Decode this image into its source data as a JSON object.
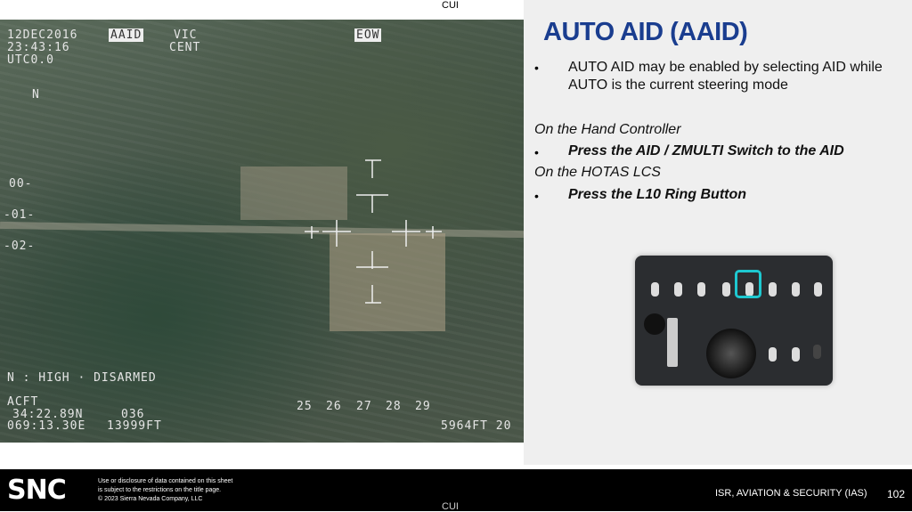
{
  "classification_top": "CUI",
  "classification_bottom": "CUI",
  "video": {
    "date": "12DEC2016",
    "time": "23:43:16",
    "utc": "UTC0.0",
    "mode_badge": "AAID",
    "vic": "VIC",
    "cent": "CENT",
    "eow": "EOW",
    "north": "N",
    "scale": [
      "00-",
      "-01-",
      "-02-"
    ],
    "status": "N : HIGH · DISARMED",
    "acft": "ACFT",
    "lat": "34:22.89N",
    "lon": "069:13.30E",
    "heading": "036",
    "altitude": "13999FT",
    "heading_ticks": [
      "25",
      "26",
      "27",
      "28",
      "29"
    ],
    "slant_range": "5964FT 20"
  },
  "slide": {
    "title": "AUTO AID (AAID)",
    "bullet1": "AUTO AID may be enabled by selecting AID while AUTO is the current steering mode",
    "section1": "On the Hand Controller",
    "bullet2": "Press the AID / ZMULTI Switch to the AID",
    "section2": "On the HOTAS LCS",
    "bullet3": "Press the L10 Ring Button",
    "bullet_char": "•"
  },
  "controller": {
    "highlight_color": "#1ec8d0"
  },
  "footer": {
    "logo": "SNC",
    "legal": [
      "Use or disclosure of data contained on this sheet",
      "is subject to the restrictions on the title page.",
      "© 2023 Sierra Nevada Company, LLC"
    ],
    "org": "ISR, AVIATION & SECURITY (IAS)",
    "page": "102"
  }
}
